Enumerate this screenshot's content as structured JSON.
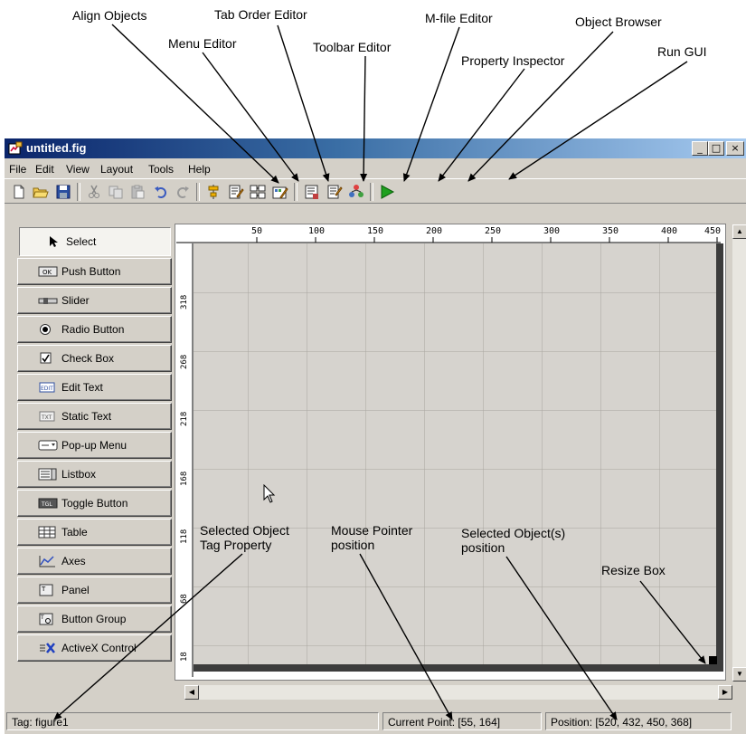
{
  "callouts": {
    "align_objects": "Align Objects",
    "tab_order_editor": "Tab Order Editor",
    "mfile_editor": "M-file Editor",
    "object_browser": "Object Browser",
    "menu_editor": "Menu Editor",
    "toolbar_editor": "Toolbar Editor",
    "property_inspector": "Property Inspector",
    "run_gui": "Run GUI",
    "selected_object_tag_line1": "Selected Object",
    "selected_object_tag_line2": "Tag Property",
    "mouse_pointer_line1": "Mouse Pointer",
    "mouse_pointer_line2": "position",
    "selected_objects_pos_line1": "Selected Object(s)",
    "selected_objects_pos_line2": "position",
    "resize_box": "Resize Box"
  },
  "window": {
    "title": "untitled.fig",
    "controls": {
      "minimize": "_",
      "maximize": "□",
      "close": "×"
    }
  },
  "menubar": [
    "File",
    "Edit",
    "View",
    "Layout",
    "Tools",
    "Help"
  ],
  "toolbar": {
    "buttons": [
      "new-icon",
      "open-icon",
      "save-icon",
      "cut-icon",
      "copy-icon",
      "paste-icon",
      "undo-icon",
      "redo-icon",
      "align-objects-icon",
      "menu-editor-icon",
      "tab-order-editor-icon",
      "toolbar-editor-icon",
      "mfile-editor-icon",
      "property-inspector-icon",
      "object-browser-icon",
      "run-gui-icon"
    ]
  },
  "palette": {
    "select": "Select",
    "items": [
      "Push Button",
      "Slider",
      "Radio Button",
      "Check Box",
      "Edit Text",
      "Static Text",
      "Pop-up Menu",
      "Listbox",
      "Toggle Button",
      "Table",
      "Axes",
      "Panel",
      "Button Group",
      "ActiveX Control"
    ]
  },
  "ruler": {
    "top": [
      "50",
      "100",
      "150",
      "200",
      "250",
      "300",
      "350",
      "400",
      "450"
    ],
    "left": [
      "318",
      "268",
      "218",
      "168",
      "118",
      "68",
      "18"
    ]
  },
  "status": {
    "tag": "Tag: figure1",
    "current_point": "Current Point:  [55, 164]",
    "position": "Position: [520, 432, 450, 368]"
  },
  "colors": {
    "window_bg": "#d4d0c8",
    "grid_bg": "#d6d3ce",
    "title_start": "#0a246a",
    "title_end": "#a6caf0",
    "run_green": "#1ea01e"
  }
}
